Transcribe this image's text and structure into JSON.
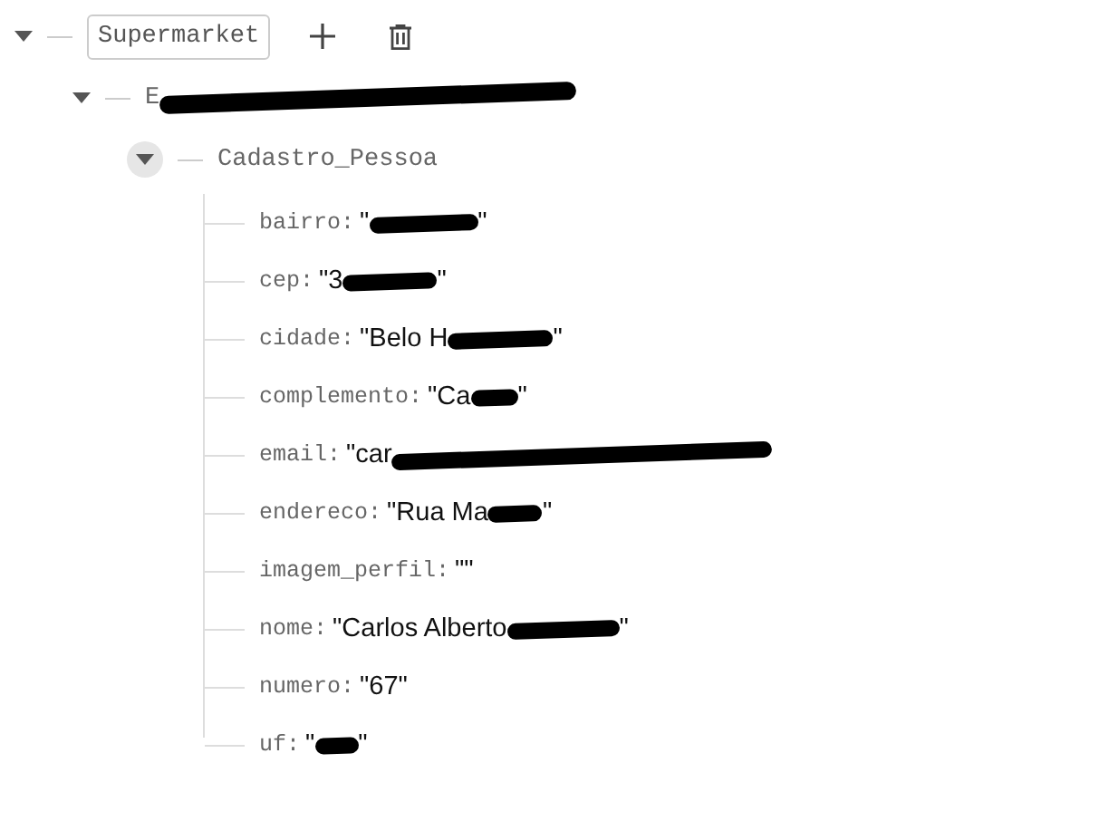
{
  "root": {
    "label": "Supermarket",
    "expanded": true
  },
  "child": {
    "label_start": "E",
    "redacted": true,
    "expanded": true
  },
  "node": {
    "label": "Cadastro_Pessoa",
    "expanded": true
  },
  "fields": [
    {
      "key": "bairro:",
      "value_start": "\"",
      "value_end": "\"",
      "redacted": true
    },
    {
      "key": "cep:",
      "value_start": "\"3",
      "value_end": "\"",
      "redacted": true
    },
    {
      "key": "cidade:",
      "value_start": "\"Belo H",
      "value_end": "\"",
      "redacted": true
    },
    {
      "key": "complemento:",
      "value_start": "\"Ca",
      "value_end": "\"",
      "redacted": true
    },
    {
      "key": "email:",
      "value_start": "\"car",
      "redacted": true
    },
    {
      "key": "endereco:",
      "value_start": "\"Rua Ma",
      "value_end": "\"",
      "redacted": true
    },
    {
      "key": "imagem_perfil:",
      "value_start": "\"\"",
      "redacted": false
    },
    {
      "key": "nome:",
      "value_start": "\"Carlos Alberto",
      "value_end": "\"",
      "redacted": true
    },
    {
      "key": "numero:",
      "value_start": "\"67\"",
      "redacted": false
    },
    {
      "key": "uf:",
      "value_start": "\"",
      "value_end": "\"",
      "redacted": true
    }
  ]
}
